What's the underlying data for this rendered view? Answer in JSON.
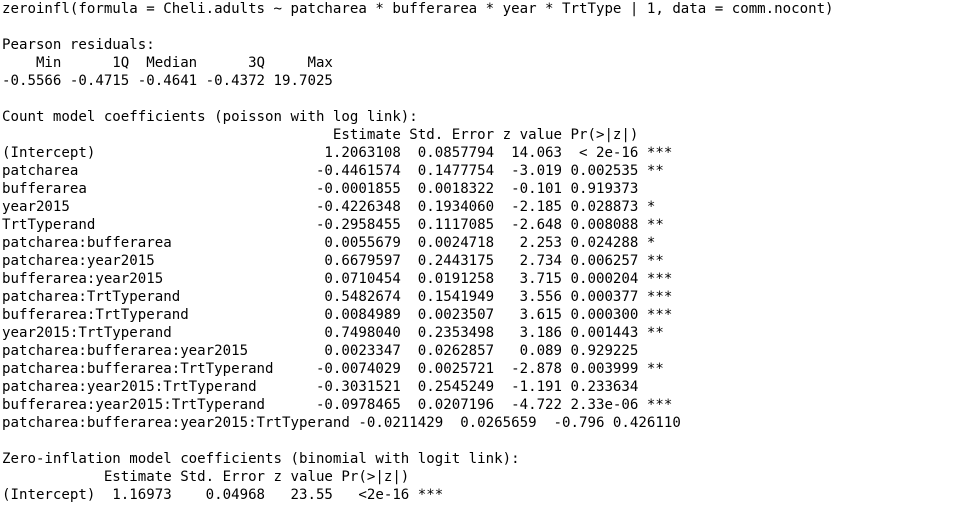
{
  "console": {
    "lines": [
      "zeroinfl(formula = Cheli.adults ~ patcharea * bufferarea * year * TrtType | 1, data = comm.nocont)",
      "",
      "Pearson residuals:",
      "    Min      1Q  Median      3Q     Max ",
      "-0.5566 -0.4715 -0.4641 -0.4372 19.7025 ",
      "",
      "Count model coefficients (poisson with log link):",
      "                                       Estimate Std. Error z value Pr(>|z|)    ",
      "(Intercept)                           1.2063108  0.0857794  14.063  < 2e-16 ***",
      "patcharea                            -0.4461574  0.1477754  -3.019 0.002535 ** ",
      "bufferarea                           -0.0001855  0.0018322  -0.101 0.919373    ",
      "year2015                             -0.4226348  0.1934060  -2.185 0.028873 *  ",
      "TrtTyperand                          -0.2958455  0.1117085  -2.648 0.008088 ** ",
      "patcharea:bufferarea                  0.0055679  0.0024718   2.253 0.024288 *  ",
      "patcharea:year2015                    0.6679597  0.2443175   2.734 0.006257 ** ",
      "bufferarea:year2015                   0.0710454  0.0191258   3.715 0.000204 ***",
      "patcharea:TrtTyperand                 0.5482674  0.1541949   3.556 0.000377 ***",
      "bufferarea:TrtTyperand                0.0084989  0.0023507   3.615 0.000300 ***",
      "year2015:TrtTyperand                  0.7498040  0.2353498   3.186 0.001443 ** ",
      "patcharea:bufferarea:year2015         0.0023347  0.0262857   0.089 0.929225    ",
      "patcharea:bufferarea:TrtTyperand     -0.0074029  0.0025721  -2.878 0.003999 ** ",
      "patcharea:year2015:TrtTyperand       -0.3031521  0.2545249  -1.191 0.233634    ",
      "bufferarea:year2015:TrtTyperand      -0.0978465  0.0207196  -4.722 2.33e-06 ***",
      "patcharea:bufferarea:year2015:TrtTyperand -0.0211429  0.0265659  -0.796 0.426110    ",
      "",
      "Zero-inflation model coefficients (binomial with logit link):",
      "            Estimate Std. Error z value Pr(>|z|)    ",
      "(Intercept)  1.16973    0.04968   23.55   <2e-16 ***"
    ]
  }
}
